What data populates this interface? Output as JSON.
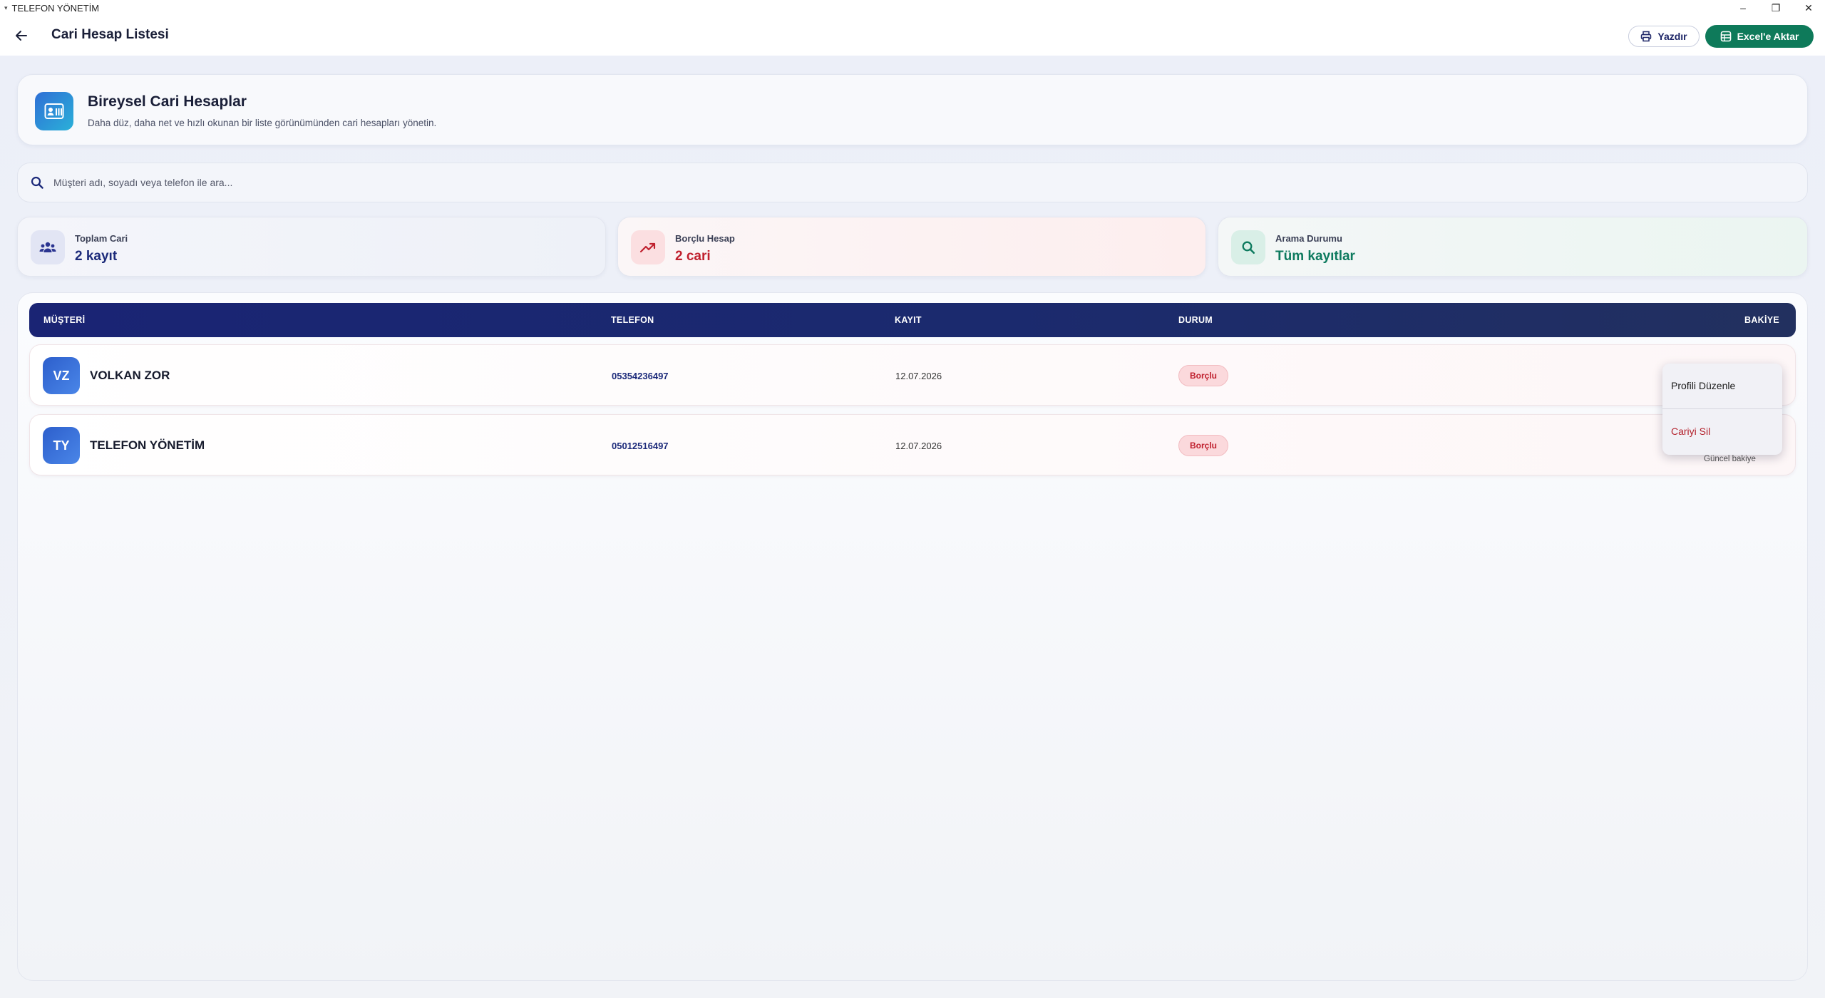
{
  "window": {
    "title": "TELEFON YÖNETİM",
    "controls": [
      "–",
      "❐",
      "✕"
    ]
  },
  "appbar": {
    "title": "Cari Hesap Listesi",
    "print_label": "Yazdır",
    "excel_label": "Excel'e Aktar"
  },
  "hero": {
    "title": "Bireysel Cari Hesaplar",
    "subtitle": "Daha düz, daha net ve hızlı okunan bir liste görünümünden cari hesapları yönetin."
  },
  "search": {
    "placeholder": "Müşteri adı, soyadı veya telefon ile ara..."
  },
  "stats": [
    {
      "label": "Toplam Cari",
      "value": "2 kayıt",
      "icon": "users-icon",
      "color": "#1c2a7a"
    },
    {
      "label": "Borçlu Hesap",
      "value": "2 cari",
      "icon": "trending-up-icon",
      "color": "#c0202e"
    },
    {
      "label": "Arama Durumu",
      "value": "Tüm kayıtlar",
      "icon": "search-icon",
      "color": "#0d7a5e"
    }
  ],
  "table": {
    "headers": [
      "MÜŞTERİ",
      "TELEFON",
      "KAYIT",
      "DURUM",
      "BAKİYE"
    ],
    "rows": [
      {
        "initials": "VZ",
        "name": "VOLKAN ZOR",
        "phone": "05354236497",
        "date": "12.07.2026",
        "status": "Borçlu"
      },
      {
        "initials": "TY",
        "name": "TELEFON YÖNETİM",
        "phone": "05012516497",
        "date": "12.07.2026",
        "status": "Borçlu",
        "balance_caption": "Güncel bakiye"
      }
    ]
  },
  "context_menu": {
    "edit_label": "Profili Düzenle",
    "delete_label": "Cariyi Sil"
  },
  "colors": {
    "accent": "#1a2474",
    "excel": "#0e7a5a",
    "danger": "#c0202e"
  }
}
